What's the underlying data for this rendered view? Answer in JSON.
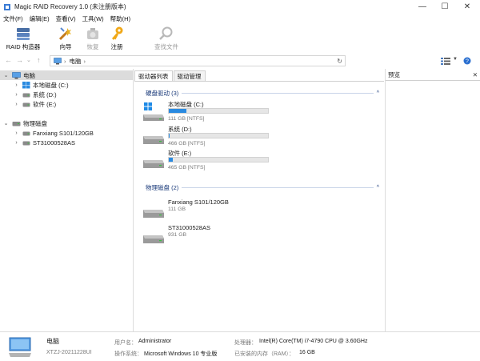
{
  "window": {
    "title": "Magic RAID Recovery 1.0 (未注册版本)",
    "minimize": "—",
    "maximize": "☐",
    "close": "✕"
  },
  "menu": [
    {
      "label": "文件(F)"
    },
    {
      "label": "编辑(E)"
    },
    {
      "label": "查看(V)"
    },
    {
      "label": "工具(W)"
    },
    {
      "label": "帮助(H)"
    }
  ],
  "toolbar": {
    "raid_builder": "RAID 构造器",
    "wizard": "向导",
    "restore": "恢复",
    "register": "注册",
    "find_file": "查找文件"
  },
  "address": {
    "path_label": "电脑",
    "separator": "›",
    "refresh": "↻"
  },
  "tree": {
    "computer": "电脑",
    "local_disk": "本地磁盘 (C:)",
    "system": "系统 (D:)",
    "software": "软件 (E:)",
    "physical": "物理磁盘",
    "disk1": "Fanxiang S101/120GB",
    "disk2": "ST31000528AS"
  },
  "tabs": [
    {
      "label": "驱动器列表"
    },
    {
      "label": "驱动管理"
    }
  ],
  "groups": {
    "logical": "硬盘驱动 (3)",
    "physical": "物理磁盘 (2)"
  },
  "drives": [
    {
      "name": "本地磁盘 (C:)",
      "info": "111 GB [NTFS]",
      "used_fraction": 0.18
    },
    {
      "name": "系统 (D:)",
      "info": "466 GB [NTFS]",
      "used_fraction": 0.01
    },
    {
      "name": "软件 (E:)",
      "info": "465 GB [NTFS]",
      "used_fraction": 0.04
    }
  ],
  "physical_drives": [
    {
      "name": "Fanxiang S101/120GB",
      "info": "111 GB"
    },
    {
      "name": "ST31000528AS",
      "info": "931 GB"
    }
  ],
  "preview": {
    "title": "预览",
    "close": "✕"
  },
  "status": {
    "computer_label": "电脑",
    "computer_id": "XTZJ-20211228UI",
    "user_key": "用户名：",
    "user_val": "Administrator",
    "os_key": "操作系统：",
    "os_val": "Microsoft Windows 10 专业版",
    "cpu_key": "处理器：",
    "cpu_val": "Intel(R) Core(TM) i7-4790 CPU @ 3.60GHz",
    "ram_key": "已安装的内存（RAM）：",
    "ram_val": "16 GB"
  },
  "colors": {
    "accent": "#2a8ae0",
    "group_header": "#1a3a7a"
  }
}
